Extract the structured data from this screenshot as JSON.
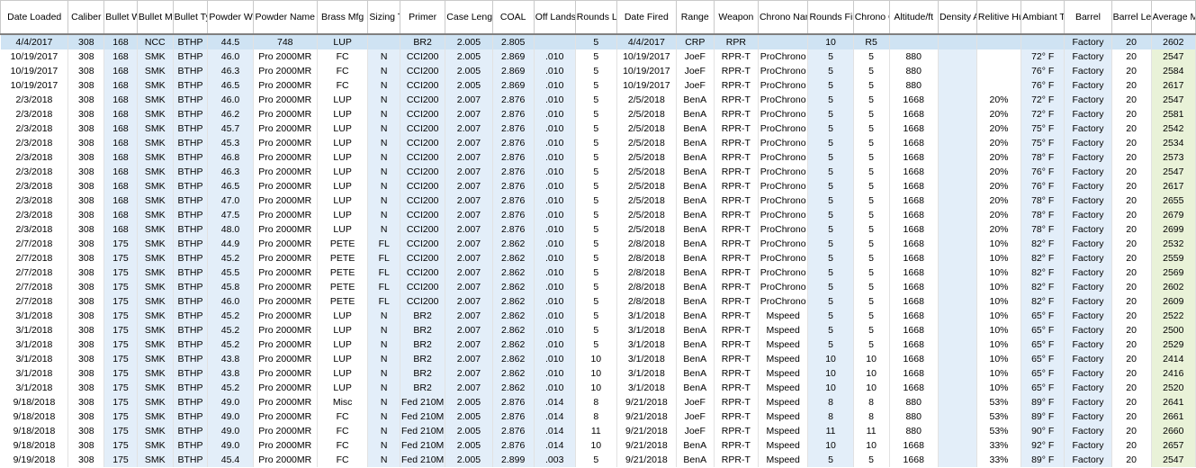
{
  "headers": [
    "Date Loaded",
    "Caliber",
    "Bullet Weight",
    "Bullet Mfg",
    "Bullet Type",
    "Powder Weight",
    "Powder Name",
    "Brass Mfg",
    "Sizing Type",
    "Primer",
    "Case Length",
    "COAL",
    "Off Lands",
    "Rounds Loaded",
    "Date Fired",
    "Range",
    "Weapon",
    "Chrono Name",
    "Rounds Fired",
    "Chrono Counts",
    "Altitude/ft",
    "Density Altitude",
    "Relitive Humidity",
    "Ambiant Temp",
    "Barrel",
    "Barrel Length",
    "Average MV"
  ],
  "rows": [
    [
      "4/4/2017",
      "308",
      "168",
      "NCC",
      "BTHP",
      "44.5",
      "748",
      "LUP",
      "",
      "BR2",
      "2.005",
      "2.805",
      "",
      "5",
      "4/4/2017",
      "CRP",
      "RPR",
      "",
      "10",
      "R5",
      "",
      "",
      "",
      "",
      "Factory",
      "20",
      "2602"
    ],
    [
      "10/19/2017",
      "308",
      "168",
      "SMK",
      "BTHP",
      "46.0",
      "Pro 2000MR",
      "FC",
      "N",
      "CCI200",
      "2.005",
      "2.869",
      ".010",
      "5",
      "10/19/2017",
      "JoeF",
      "RPR-T",
      "ProChrono",
      "5",
      "5",
      "880",
      "",
      "",
      "72° F",
      "Factory",
      "20",
      "2547"
    ],
    [
      "10/19/2017",
      "308",
      "168",
      "SMK",
      "BTHP",
      "46.3",
      "Pro 2000MR",
      "FC",
      "N",
      "CCI200",
      "2.005",
      "2.869",
      ".010",
      "5",
      "10/19/2017",
      "JoeF",
      "RPR-T",
      "ProChrono",
      "5",
      "5",
      "880",
      "",
      "",
      "76° F",
      "Factory",
      "20",
      "2584"
    ],
    [
      "10/19/2017",
      "308",
      "168",
      "SMK",
      "BTHP",
      "46.5",
      "Pro 2000MR",
      "FC",
      "N",
      "CCI200",
      "2.005",
      "2.869",
      ".010",
      "5",
      "10/19/2017",
      "JoeF",
      "RPR-T",
      "ProChrono",
      "5",
      "5",
      "880",
      "",
      "",
      "76° F",
      "Factory",
      "20",
      "2617"
    ],
    [
      "2/3/2018",
      "308",
      "168",
      "SMK",
      "BTHP",
      "46.0",
      "Pro 2000MR",
      "LUP",
      "N",
      "CCI200",
      "2.007",
      "2.876",
      ".010",
      "5",
      "2/5/2018",
      "BenA",
      "RPR-T",
      "ProChrono",
      "5",
      "5",
      "1668",
      "",
      "20%",
      "72° F",
      "Factory",
      "20",
      "2547"
    ],
    [
      "2/3/2018",
      "308",
      "168",
      "SMK",
      "BTHP",
      "46.2",
      "Pro 2000MR",
      "LUP",
      "N",
      "CCI200",
      "2.007",
      "2.876",
      ".010",
      "5",
      "2/5/2018",
      "BenA",
      "RPR-T",
      "ProChrono",
      "5",
      "5",
      "1668",
      "",
      "20%",
      "72° F",
      "Factory",
      "20",
      "2581"
    ],
    [
      "2/3/2018",
      "308",
      "168",
      "SMK",
      "BTHP",
      "45.7",
      "Pro 2000MR",
      "LUP",
      "N",
      "CCI200",
      "2.007",
      "2.876",
      ".010",
      "5",
      "2/5/2018",
      "BenA",
      "RPR-T",
      "ProChrono",
      "5",
      "5",
      "1668",
      "",
      "20%",
      "75° F",
      "Factory",
      "20",
      "2542"
    ],
    [
      "2/3/2018",
      "308",
      "168",
      "SMK",
      "BTHP",
      "45.3",
      "Pro 2000MR",
      "LUP",
      "N",
      "CCI200",
      "2.007",
      "2.876",
      ".010",
      "5",
      "2/5/2018",
      "BenA",
      "RPR-T",
      "ProChrono",
      "5",
      "5",
      "1668",
      "",
      "20%",
      "75° F",
      "Factory",
      "20",
      "2534"
    ],
    [
      "2/3/2018",
      "308",
      "168",
      "SMK",
      "BTHP",
      "46.8",
      "Pro 2000MR",
      "LUP",
      "N",
      "CCI200",
      "2.007",
      "2.876",
      ".010",
      "5",
      "2/5/2018",
      "BenA",
      "RPR-T",
      "ProChrono",
      "5",
      "5",
      "1668",
      "",
      "20%",
      "78° F",
      "Factory",
      "20",
      "2573"
    ],
    [
      "2/3/2018",
      "308",
      "168",
      "SMK",
      "BTHP",
      "46.3",
      "Pro 2000MR",
      "LUP",
      "N",
      "CCI200",
      "2.007",
      "2.876",
      ".010",
      "5",
      "2/5/2018",
      "BenA",
      "RPR-T",
      "ProChrono",
      "5",
      "5",
      "1668",
      "",
      "20%",
      "76° F",
      "Factory",
      "20",
      "2547"
    ],
    [
      "2/3/2018",
      "308",
      "168",
      "SMK",
      "BTHP",
      "46.5",
      "Pro 2000MR",
      "LUP",
      "N",
      "CCI200",
      "2.007",
      "2.876",
      ".010",
      "5",
      "2/5/2018",
      "BenA",
      "RPR-T",
      "ProChrono",
      "5",
      "5",
      "1668",
      "",
      "20%",
      "76° F",
      "Factory",
      "20",
      "2617"
    ],
    [
      "2/3/2018",
      "308",
      "168",
      "SMK",
      "BTHP",
      "47.0",
      "Pro 2000MR",
      "LUP",
      "N",
      "CCI200",
      "2.007",
      "2.876",
      ".010",
      "5",
      "2/5/2018",
      "BenA",
      "RPR-T",
      "ProChrono",
      "5",
      "5",
      "1668",
      "",
      "20%",
      "78° F",
      "Factory",
      "20",
      "2655"
    ],
    [
      "2/3/2018",
      "308",
      "168",
      "SMK",
      "BTHP",
      "47.5",
      "Pro 2000MR",
      "LUP",
      "N",
      "CCI200",
      "2.007",
      "2.876",
      ".010",
      "5",
      "2/5/2018",
      "BenA",
      "RPR-T",
      "ProChrono",
      "5",
      "5",
      "1668",
      "",
      "20%",
      "78° F",
      "Factory",
      "20",
      "2679"
    ],
    [
      "2/3/2018",
      "308",
      "168",
      "SMK",
      "BTHP",
      "48.0",
      "Pro 2000MR",
      "LUP",
      "N",
      "CCI200",
      "2.007",
      "2.876",
      ".010",
      "5",
      "2/5/2018",
      "BenA",
      "RPR-T",
      "ProChrono",
      "5",
      "5",
      "1668",
      "",
      "20%",
      "78° F",
      "Factory",
      "20",
      "2699"
    ],
    [
      "2/7/2018",
      "308",
      "175",
      "SMK",
      "BTHP",
      "44.9",
      "Pro 2000MR",
      "PETE",
      "FL",
      "CCI200",
      "2.007",
      "2.862",
      ".010",
      "5",
      "2/8/2018",
      "BenA",
      "RPR-T",
      "ProChrono",
      "5",
      "5",
      "1668",
      "",
      "10%",
      "82° F",
      "Factory",
      "20",
      "2532"
    ],
    [
      "2/7/2018",
      "308",
      "175",
      "SMK",
      "BTHP",
      "45.2",
      "Pro 2000MR",
      "PETE",
      "FL",
      "CCI200",
      "2.007",
      "2.862",
      ".010",
      "5",
      "2/8/2018",
      "BenA",
      "RPR-T",
      "ProChrono",
      "5",
      "5",
      "1668",
      "",
      "10%",
      "82° F",
      "Factory",
      "20",
      "2559"
    ],
    [
      "2/7/2018",
      "308",
      "175",
      "SMK",
      "BTHP",
      "45.5",
      "Pro 2000MR",
      "PETE",
      "FL",
      "CCI200",
      "2.007",
      "2.862",
      ".010",
      "5",
      "2/8/2018",
      "BenA",
      "RPR-T",
      "ProChrono",
      "5",
      "5",
      "1668",
      "",
      "10%",
      "82° F",
      "Factory",
      "20",
      "2569"
    ],
    [
      "2/7/2018",
      "308",
      "175",
      "SMK",
      "BTHP",
      "45.8",
      "Pro 2000MR",
      "PETE",
      "FL",
      "CCI200",
      "2.007",
      "2.862",
      ".010",
      "5",
      "2/8/2018",
      "BenA",
      "RPR-T",
      "ProChrono",
      "5",
      "5",
      "1668",
      "",
      "10%",
      "82° F",
      "Factory",
      "20",
      "2602"
    ],
    [
      "2/7/2018",
      "308",
      "175",
      "SMK",
      "BTHP",
      "46.0",
      "Pro 2000MR",
      "PETE",
      "FL",
      "CCI200",
      "2.007",
      "2.862",
      ".010",
      "5",
      "2/8/2018",
      "BenA",
      "RPR-T",
      "ProChrono",
      "5",
      "5",
      "1668",
      "",
      "10%",
      "82° F",
      "Factory",
      "20",
      "2609"
    ],
    [
      "3/1/2018",
      "308",
      "175",
      "SMK",
      "BTHP",
      "45.2",
      "Pro 2000MR",
      "LUP",
      "N",
      "BR2",
      "2.007",
      "2.862",
      ".010",
      "5",
      "3/1/2018",
      "BenA",
      "RPR-T",
      "Mspeed",
      "5",
      "5",
      "1668",
      "",
      "10%",
      "65° F",
      "Factory",
      "20",
      "2522"
    ],
    [
      "3/1/2018",
      "308",
      "175",
      "SMK",
      "BTHP",
      "45.2",
      "Pro 2000MR",
      "LUP",
      "N",
      "BR2",
      "2.007",
      "2.862",
      ".010",
      "5",
      "3/1/2018",
      "BenA",
      "RPR-T",
      "Mspeed",
      "5",
      "5",
      "1668",
      "",
      "10%",
      "65° F",
      "Factory",
      "20",
      "2500"
    ],
    [
      "3/1/2018",
      "308",
      "175",
      "SMK",
      "BTHP",
      "45.2",
      "Pro 2000MR",
      "LUP",
      "N",
      "BR2",
      "2.007",
      "2.862",
      ".010",
      "5",
      "3/1/2018",
      "BenA",
      "RPR-T",
      "Mspeed",
      "5",
      "5",
      "1668",
      "",
      "10%",
      "65° F",
      "Factory",
      "20",
      "2529"
    ],
    [
      "3/1/2018",
      "308",
      "175",
      "SMK",
      "BTHP",
      "43.8",
      "Pro 2000MR",
      "LUP",
      "N",
      "BR2",
      "2.007",
      "2.862",
      ".010",
      "10",
      "3/1/2018",
      "BenA",
      "RPR-T",
      "Mspeed",
      "10",
      "10",
      "1668",
      "",
      "10%",
      "65° F",
      "Factory",
      "20",
      "2414"
    ],
    [
      "3/1/2018",
      "308",
      "175",
      "SMK",
      "BTHP",
      "43.8",
      "Pro 2000MR",
      "LUP",
      "N",
      "BR2",
      "2.007",
      "2.862",
      ".010",
      "10",
      "3/1/2018",
      "BenA",
      "RPR-T",
      "Mspeed",
      "10",
      "10",
      "1668",
      "",
      "10%",
      "65° F",
      "Factory",
      "20",
      "2416"
    ],
    [
      "3/1/2018",
      "308",
      "175",
      "SMK",
      "BTHP",
      "45.2",
      "Pro 2000MR",
      "LUP",
      "N",
      "BR2",
      "2.007",
      "2.862",
      ".010",
      "10",
      "3/1/2018",
      "BenA",
      "RPR-T",
      "Mspeed",
      "10",
      "10",
      "1668",
      "",
      "10%",
      "65° F",
      "Factory",
      "20",
      "2520"
    ],
    [
      "9/18/2018",
      "308",
      "175",
      "SMK",
      "BTHP",
      "49.0",
      "Pro 2000MR",
      "Misc",
      "N",
      "Fed 210M",
      "2.005",
      "2.876",
      ".014",
      "8",
      "9/21/2018",
      "JoeF",
      "RPR-T",
      "Mspeed",
      "8",
      "8",
      "880",
      "",
      "53%",
      "89° F",
      "Factory",
      "20",
      "2641"
    ],
    [
      "9/18/2018",
      "308",
      "175",
      "SMK",
      "BTHP",
      "49.0",
      "Pro 2000MR",
      "FC",
      "N",
      "Fed 210M",
      "2.005",
      "2.876",
      ".014",
      "8",
      "9/21/2018",
      "JoeF",
      "RPR-T",
      "Mspeed",
      "8",
      "8",
      "880",
      "",
      "53%",
      "89° F",
      "Factory",
      "20",
      "2661"
    ],
    [
      "9/18/2018",
      "308",
      "175",
      "SMK",
      "BTHP",
      "49.0",
      "Pro 2000MR",
      "FC",
      "N",
      "Fed 210M",
      "2.005",
      "2.876",
      ".014",
      "11",
      "9/21/2018",
      "JoeF",
      "RPR-T",
      "Mspeed",
      "11",
      "11",
      "880",
      "",
      "53%",
      "90° F",
      "Factory",
      "20",
      "2660"
    ],
    [
      "9/18/2018",
      "308",
      "175",
      "SMK",
      "BTHP",
      "49.0",
      "Pro 2000MR",
      "FC",
      "N",
      "Fed 210M",
      "2.005",
      "2.876",
      ".014",
      "10",
      "9/21/2018",
      "BenA",
      "RPR-T",
      "Mspeed",
      "10",
      "10",
      "1668",
      "",
      "33%",
      "92° F",
      "Factory",
      "20",
      "2657"
    ],
    [
      "9/19/2018",
      "308",
      "175",
      "SMK",
      "BTHP",
      "45.4",
      "Pro 2000MR",
      "FC",
      "N",
      "Fed 210M",
      "2.005",
      "2.899",
      ".003",
      "5",
      "9/21/2018",
      "BenA",
      "RPR-T",
      "Mspeed",
      "5",
      "5",
      "1668",
      "",
      "33%",
      "89° F",
      "Factory",
      "20",
      "2547"
    ]
  ]
}
